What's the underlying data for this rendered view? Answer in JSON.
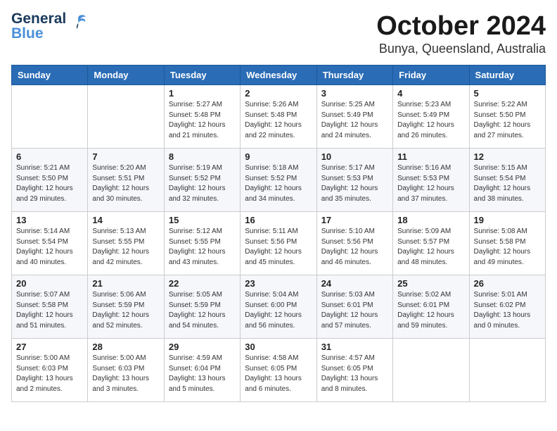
{
  "logo": {
    "line1": "General",
    "line2": "Blue"
  },
  "title": "October 2024",
  "location": "Bunya, Queensland, Australia",
  "headers": [
    "Sunday",
    "Monday",
    "Tuesday",
    "Wednesday",
    "Thursday",
    "Friday",
    "Saturday"
  ],
  "weeks": [
    [
      {
        "day": "",
        "sunrise": "",
        "sunset": "",
        "daylight": ""
      },
      {
        "day": "",
        "sunrise": "",
        "sunset": "",
        "daylight": ""
      },
      {
        "day": "1",
        "sunrise": "Sunrise: 5:27 AM",
        "sunset": "Sunset: 5:48 PM",
        "daylight": "Daylight: 12 hours and 21 minutes."
      },
      {
        "day": "2",
        "sunrise": "Sunrise: 5:26 AM",
        "sunset": "Sunset: 5:48 PM",
        "daylight": "Daylight: 12 hours and 22 minutes."
      },
      {
        "day": "3",
        "sunrise": "Sunrise: 5:25 AM",
        "sunset": "Sunset: 5:49 PM",
        "daylight": "Daylight: 12 hours and 24 minutes."
      },
      {
        "day": "4",
        "sunrise": "Sunrise: 5:23 AM",
        "sunset": "Sunset: 5:49 PM",
        "daylight": "Daylight: 12 hours and 26 minutes."
      },
      {
        "day": "5",
        "sunrise": "Sunrise: 5:22 AM",
        "sunset": "Sunset: 5:50 PM",
        "daylight": "Daylight: 12 hours and 27 minutes."
      }
    ],
    [
      {
        "day": "6",
        "sunrise": "Sunrise: 5:21 AM",
        "sunset": "Sunset: 5:50 PM",
        "daylight": "Daylight: 12 hours and 29 minutes."
      },
      {
        "day": "7",
        "sunrise": "Sunrise: 5:20 AM",
        "sunset": "Sunset: 5:51 PM",
        "daylight": "Daylight: 12 hours and 30 minutes."
      },
      {
        "day": "8",
        "sunrise": "Sunrise: 5:19 AM",
        "sunset": "Sunset: 5:52 PM",
        "daylight": "Daylight: 12 hours and 32 minutes."
      },
      {
        "day": "9",
        "sunrise": "Sunrise: 5:18 AM",
        "sunset": "Sunset: 5:52 PM",
        "daylight": "Daylight: 12 hours and 34 minutes."
      },
      {
        "day": "10",
        "sunrise": "Sunrise: 5:17 AM",
        "sunset": "Sunset: 5:53 PM",
        "daylight": "Daylight: 12 hours and 35 minutes."
      },
      {
        "day": "11",
        "sunrise": "Sunrise: 5:16 AM",
        "sunset": "Sunset: 5:53 PM",
        "daylight": "Daylight: 12 hours and 37 minutes."
      },
      {
        "day": "12",
        "sunrise": "Sunrise: 5:15 AM",
        "sunset": "Sunset: 5:54 PM",
        "daylight": "Daylight: 12 hours and 38 minutes."
      }
    ],
    [
      {
        "day": "13",
        "sunrise": "Sunrise: 5:14 AM",
        "sunset": "Sunset: 5:54 PM",
        "daylight": "Daylight: 12 hours and 40 minutes."
      },
      {
        "day": "14",
        "sunrise": "Sunrise: 5:13 AM",
        "sunset": "Sunset: 5:55 PM",
        "daylight": "Daylight: 12 hours and 42 minutes."
      },
      {
        "day": "15",
        "sunrise": "Sunrise: 5:12 AM",
        "sunset": "Sunset: 5:55 PM",
        "daylight": "Daylight: 12 hours and 43 minutes."
      },
      {
        "day": "16",
        "sunrise": "Sunrise: 5:11 AM",
        "sunset": "Sunset: 5:56 PM",
        "daylight": "Daylight: 12 hours and 45 minutes."
      },
      {
        "day": "17",
        "sunrise": "Sunrise: 5:10 AM",
        "sunset": "Sunset: 5:56 PM",
        "daylight": "Daylight: 12 hours and 46 minutes."
      },
      {
        "day": "18",
        "sunrise": "Sunrise: 5:09 AM",
        "sunset": "Sunset: 5:57 PM",
        "daylight": "Daylight: 12 hours and 48 minutes."
      },
      {
        "day": "19",
        "sunrise": "Sunrise: 5:08 AM",
        "sunset": "Sunset: 5:58 PM",
        "daylight": "Daylight: 12 hours and 49 minutes."
      }
    ],
    [
      {
        "day": "20",
        "sunrise": "Sunrise: 5:07 AM",
        "sunset": "Sunset: 5:58 PM",
        "daylight": "Daylight: 12 hours and 51 minutes."
      },
      {
        "day": "21",
        "sunrise": "Sunrise: 5:06 AM",
        "sunset": "Sunset: 5:59 PM",
        "daylight": "Daylight: 12 hours and 52 minutes."
      },
      {
        "day": "22",
        "sunrise": "Sunrise: 5:05 AM",
        "sunset": "Sunset: 5:59 PM",
        "daylight": "Daylight: 12 hours and 54 minutes."
      },
      {
        "day": "23",
        "sunrise": "Sunrise: 5:04 AM",
        "sunset": "Sunset: 6:00 PM",
        "daylight": "Daylight: 12 hours and 56 minutes."
      },
      {
        "day": "24",
        "sunrise": "Sunrise: 5:03 AM",
        "sunset": "Sunset: 6:01 PM",
        "daylight": "Daylight: 12 hours and 57 minutes."
      },
      {
        "day": "25",
        "sunrise": "Sunrise: 5:02 AM",
        "sunset": "Sunset: 6:01 PM",
        "daylight": "Daylight: 12 hours and 59 minutes."
      },
      {
        "day": "26",
        "sunrise": "Sunrise: 5:01 AM",
        "sunset": "Sunset: 6:02 PM",
        "daylight": "Daylight: 13 hours and 0 minutes."
      }
    ],
    [
      {
        "day": "27",
        "sunrise": "Sunrise: 5:00 AM",
        "sunset": "Sunset: 6:03 PM",
        "daylight": "Daylight: 13 hours and 2 minutes."
      },
      {
        "day": "28",
        "sunrise": "Sunrise: 5:00 AM",
        "sunset": "Sunset: 6:03 PM",
        "daylight": "Daylight: 13 hours and 3 minutes."
      },
      {
        "day": "29",
        "sunrise": "Sunrise: 4:59 AM",
        "sunset": "Sunset: 6:04 PM",
        "daylight": "Daylight: 13 hours and 5 minutes."
      },
      {
        "day": "30",
        "sunrise": "Sunrise: 4:58 AM",
        "sunset": "Sunset: 6:05 PM",
        "daylight": "Daylight: 13 hours and 6 minutes."
      },
      {
        "day": "31",
        "sunrise": "Sunrise: 4:57 AM",
        "sunset": "Sunset: 6:05 PM",
        "daylight": "Daylight: 13 hours and 8 minutes."
      },
      {
        "day": "",
        "sunrise": "",
        "sunset": "",
        "daylight": ""
      },
      {
        "day": "",
        "sunrise": "",
        "sunset": "",
        "daylight": ""
      }
    ]
  ]
}
